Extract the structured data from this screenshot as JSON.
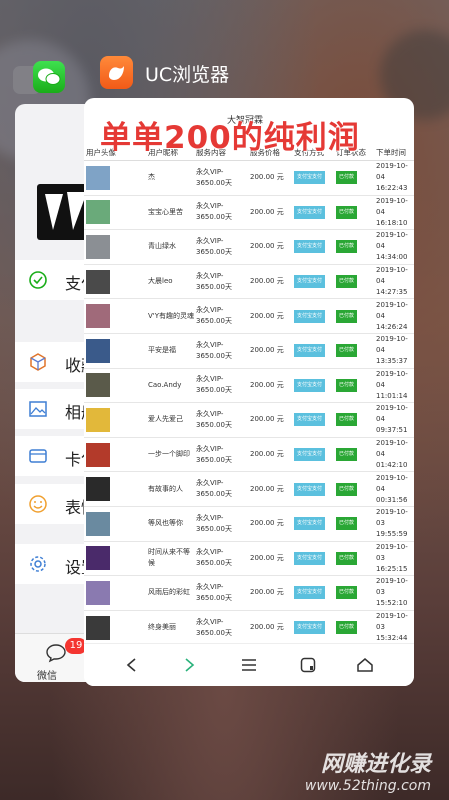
{
  "overlay_title": "单单200的纯利润",
  "uc": {
    "title": "UC浏览器"
  },
  "wechat": {
    "rows": [
      "支付",
      "收藏",
      "相册",
      "卡包",
      "表情",
      "设置"
    ],
    "tab_label": "微信",
    "badge": "19"
  },
  "page": {
    "title": "大智冠霖"
  },
  "table": {
    "headers": [
      "用户头像",
      "用户昵称",
      "服务内容",
      "服务价格",
      "支付方式",
      "订单状态",
      "下单时间"
    ],
    "rows": [
      {
        "name": "杰",
        "service": "永久VIP-3650.00天",
        "price": "200.00 元",
        "pay": "支付宝支付",
        "status": "已付款",
        "date": "2019-10-04",
        "time": "16:22:43",
        "color": "#7fa3c6"
      },
      {
        "name": "宝宝心里苦",
        "service": "永久VIP-3650.00天",
        "price": "200.00 元",
        "pay": "支付宝支付",
        "status": "已付款",
        "date": "2019-10-04",
        "time": "16:18:10",
        "color": "#6aaa7a"
      },
      {
        "name": "青山绿水",
        "service": "永久VIP-3650.00天",
        "price": "200.00 元",
        "pay": "支付宝支付",
        "status": "已付款",
        "date": "2019-10-04",
        "time": "14:34:00",
        "color": "#8b8f94"
      },
      {
        "name": "大晨leo",
        "service": "永久VIP-3650.00天",
        "price": "200.00 元",
        "pay": "支付宝支付",
        "status": "已付款",
        "date": "2019-10-04",
        "time": "14:27:35",
        "color": "#4a4a4a"
      },
      {
        "name": "V'Y有趣的灵魂",
        "service": "永久VIP-3650.00天",
        "price": "200.00 元",
        "pay": "支付宝支付",
        "status": "已付款",
        "date": "2019-10-04",
        "time": "14:26:24",
        "color": "#a06a7a"
      },
      {
        "name": "平安是福",
        "service": "永久VIP-3650.00天",
        "price": "200.00 元",
        "pay": "支付宝支付",
        "status": "已付款",
        "date": "2019-10-04",
        "time": "13:35:37",
        "color": "#3a5a8a"
      },
      {
        "name": "Cao.Andy",
        "service": "永久VIP-3650.00天",
        "price": "200.00 元",
        "pay": "支付宝支付",
        "status": "已付款",
        "date": "2019-10-04",
        "time": "11:01:14",
        "color": "#5a5a4a"
      },
      {
        "name": "爱人先爱己",
        "service": "永久VIP-3650.00天",
        "price": "200.00 元",
        "pay": "支付宝支付",
        "status": "已付款",
        "date": "2019-10-04",
        "time": "09:37:51",
        "color": "#e2b83a"
      },
      {
        "name": "一步一个脚印",
        "service": "永久VIP-3650.00天",
        "price": "200.00 元",
        "pay": "支付宝支付",
        "status": "已付款",
        "date": "2019-10-04",
        "time": "01:42:10",
        "color": "#b33a2a"
      },
      {
        "name": "有故事的人",
        "service": "永久VIP-3650.00天",
        "price": "200.00 元",
        "pay": "支付宝支付",
        "status": "已付款",
        "date": "2019-10-04",
        "time": "00:31:56",
        "color": "#2a2a2a"
      },
      {
        "name": "等风也等你",
        "service": "永久VIP-3650.00天",
        "price": "200.00 元",
        "pay": "支付宝支付",
        "status": "已付款",
        "date": "2019-10-03",
        "time": "19:55:59",
        "color": "#6a8aa0"
      },
      {
        "name": "时间从来不等候",
        "service": "永久VIP-3650.00天",
        "price": "200.00 元",
        "pay": "支付宝支付",
        "status": "已付款",
        "date": "2019-10-03",
        "time": "16:25:15",
        "color": "#4a2a6a"
      },
      {
        "name": "风雨后的彩虹",
        "service": "永久VIP-3650.00天",
        "price": "200.00 元",
        "pay": "支付宝支付",
        "status": "已付款",
        "date": "2019-10-03",
        "time": "15:52:10",
        "color": "#8a7ab0"
      },
      {
        "name": "终身美丽",
        "service": "永久VIP-3650.00天",
        "price": "200.00 元",
        "pay": "支付宝支付",
        "status": "已付款",
        "date": "2019-10-03",
        "time": "15:32:44",
        "color": "#3a3a3a"
      }
    ]
  },
  "watermark": {
    "line1": "网赚进化录",
    "line2": "www.52thing.com"
  }
}
